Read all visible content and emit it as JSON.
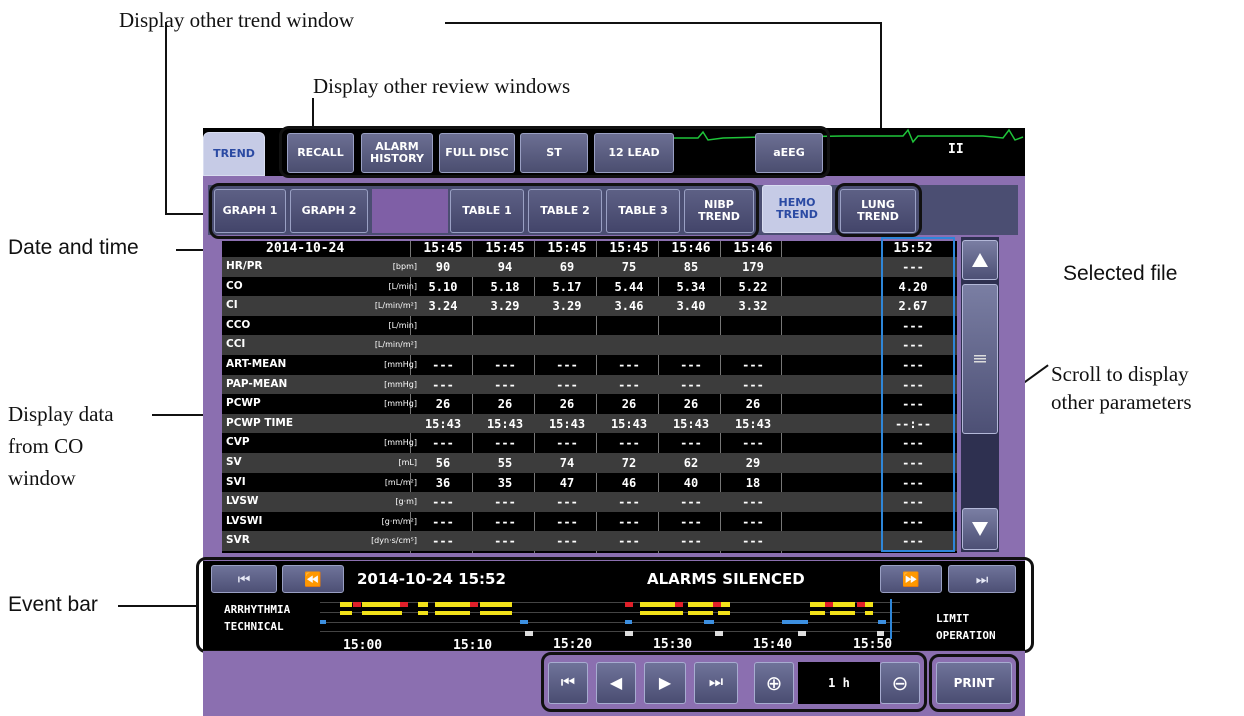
{
  "annotations": {
    "trend_window": "Display other trend window",
    "review_windows": "Display other review windows",
    "date_time": "Date and time",
    "selected_file": "Selected file",
    "scroll": [
      "Scroll to display",
      "other parameters"
    ],
    "co_window": [
      "Display data",
      "from CO",
      "window"
    ],
    "event_bar": "Event bar"
  },
  "top_tabs": [
    {
      "label": "TREND",
      "active": true
    },
    {
      "label": "RECALL"
    },
    {
      "label": "ALARM HISTORY"
    },
    {
      "label": "FULL DISC"
    },
    {
      "label": "ST"
    },
    {
      "label": "12 LEAD"
    },
    {
      "label": "aEEG"
    }
  ],
  "lead_label": "II",
  "sub_tabs": [
    {
      "label": "GRAPH 1"
    },
    {
      "label": "GRAPH 2"
    },
    {
      "label": "TABLE 1"
    },
    {
      "label": "TABLE 2"
    },
    {
      "label": "TABLE 3"
    },
    {
      "label": "NIBP TREND"
    },
    {
      "label": "HEMO TREND",
      "active": true
    },
    {
      "label": "LUNG TREND"
    }
  ],
  "table": {
    "date": "2014-10-24",
    "times": [
      "15:45",
      "15:45",
      "15:45",
      "15:45",
      "15:46",
      "15:46",
      "15:52"
    ],
    "rows": [
      {
        "name": "HR/PR",
        "unit": "[bpm]",
        "values": [
          "90",
          "94",
          "69",
          "75",
          "85",
          "179",
          "---"
        ]
      },
      {
        "name": "CO",
        "unit": "[L/min]",
        "values": [
          "5.10",
          "5.18",
          "5.17",
          "5.44",
          "5.34",
          "5.22",
          "4.20"
        ]
      },
      {
        "name": "CI",
        "unit": "[L/min/m²]",
        "values": [
          "3.24",
          "3.29",
          "3.29",
          "3.46",
          "3.40",
          "3.32",
          "2.67"
        ]
      },
      {
        "name": "CCO",
        "unit": "[L/min]",
        "values": [
          "",
          "",
          "",
          "",
          "",
          "",
          "---"
        ]
      },
      {
        "name": "CCI",
        "unit": "[L/min/m²]",
        "values": [
          "",
          "",
          "",
          "",
          "",
          "",
          "---"
        ]
      },
      {
        "name": "ART-MEAN",
        "unit": "[mmHg]",
        "values": [
          "---",
          "---",
          "---",
          "---",
          "---",
          "---",
          "---"
        ]
      },
      {
        "name": "PAP-MEAN",
        "unit": "[mmHg]",
        "values": [
          "---",
          "---",
          "---",
          "---",
          "---",
          "---",
          "---"
        ]
      },
      {
        "name": "PCWP",
        "unit": "[mmHg]",
        "values": [
          "26",
          "26",
          "26",
          "26",
          "26",
          "26",
          "---"
        ]
      },
      {
        "name": "PCWP TIME",
        "unit": "",
        "values": [
          "15:43",
          "15:43",
          "15:43",
          "15:43",
          "15:43",
          "15:43",
          "--:--"
        ]
      },
      {
        "name": "CVP",
        "unit": "[mmHg]",
        "values": [
          "---",
          "---",
          "---",
          "---",
          "---",
          "---",
          "---"
        ]
      },
      {
        "name": "SV",
        "unit": "[mL]",
        "values": [
          "56",
          "55",
          "74",
          "72",
          "62",
          "29",
          "---"
        ]
      },
      {
        "name": "SVI",
        "unit": "[mL/m²]",
        "values": [
          "36",
          "35",
          "47",
          "46",
          "40",
          "18",
          "---"
        ]
      },
      {
        "name": "LVSW",
        "unit": "[g·m]",
        "values": [
          "---",
          "---",
          "---",
          "---",
          "---",
          "---",
          "---"
        ]
      },
      {
        "name": "LVSWI",
        "unit": "[g·m/m²]",
        "values": [
          "---",
          "---",
          "---",
          "---",
          "---",
          "---",
          "---"
        ]
      },
      {
        "name": "SVR",
        "unit": "[dyn·s/cm⁵]",
        "values": [
          "---",
          "---",
          "---",
          "---",
          "---",
          "---",
          "---"
        ]
      }
    ]
  },
  "event_bar": {
    "datetime": "2014-10-24 15:52",
    "message": "ALARMS SILENCED",
    "rows": [
      "ARRHYTHMIA",
      "TECHNICAL"
    ],
    "right_labels": [
      "LIMIT",
      "OPERATION"
    ],
    "axis_times": [
      "15:00",
      "15:10",
      "15:20",
      "15:30",
      "15:40",
      "15:50"
    ]
  },
  "zoom": "1 h",
  "print_label": "PRINT",
  "colors": {
    "frame": "#8b6fb0",
    "selected": "#2e86d9",
    "alarm_red": "#e0202a",
    "alarm_yellow": "#f2e21a",
    "tech_blue": "#3c8fe0"
  }
}
